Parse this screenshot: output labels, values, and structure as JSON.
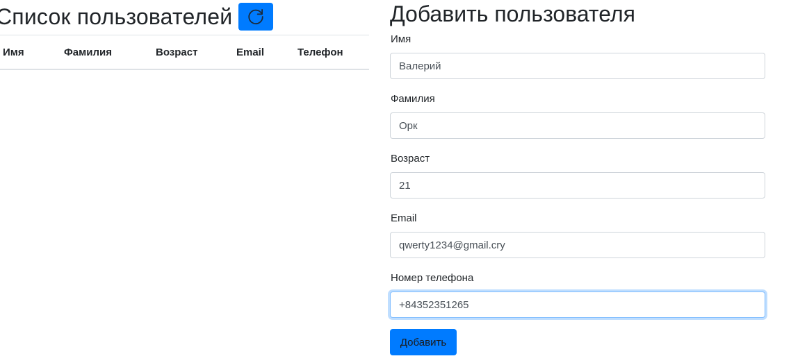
{
  "user_list": {
    "title": "Список пользователей",
    "refresh_icon": "refresh-icon",
    "columns": [
      "Имя",
      "Фамилия",
      "Возраст",
      "Email",
      "Телефон"
    ],
    "rows": []
  },
  "add_user_form": {
    "title": "Добавить пользователя",
    "fields": {
      "first_name": {
        "label": "Имя",
        "value": "Валерий"
      },
      "last_name": {
        "label": "Фамилия",
        "value": "Орк"
      },
      "age": {
        "label": "Возраст",
        "value": "21"
      },
      "email": {
        "label": "Email",
        "value": "qwerty1234@gmail.cry"
      },
      "phone": {
        "label": "Номер телефона",
        "value": "+84352351265"
      }
    },
    "submit_label": "Добавить"
  },
  "colors": {
    "primary": "#007bff",
    "text": "#212529",
    "border": "#dee2e6",
    "input_border": "#ced4da",
    "focus_border": "#80bdff"
  }
}
